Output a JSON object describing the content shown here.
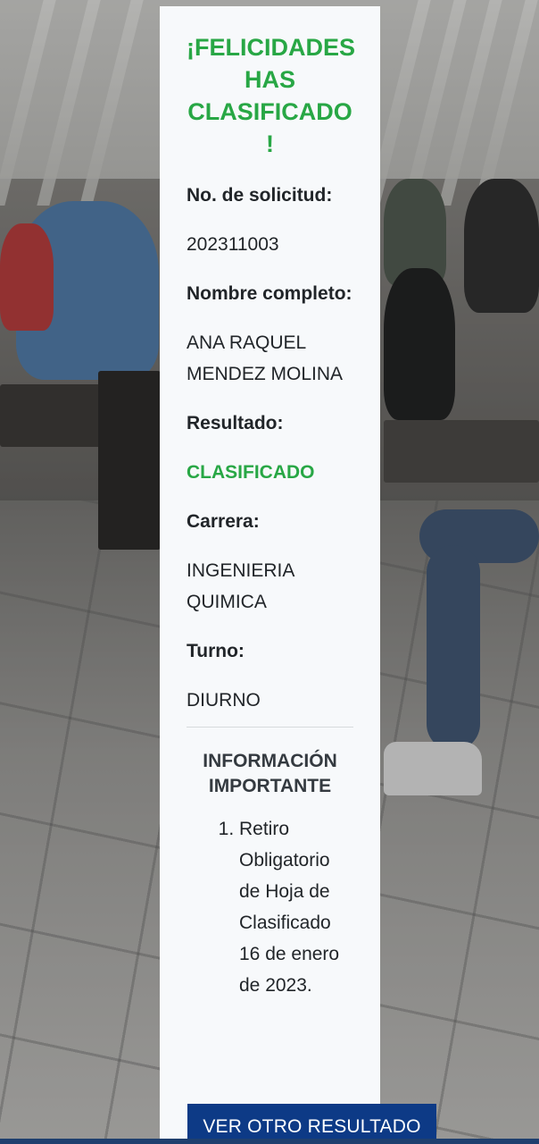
{
  "card": {
    "title": "¡FELICIDADES HAS CLASIFICADO !",
    "fields": {
      "solicitud_label": "No. de solicitud:",
      "solicitud_value": "202311003",
      "nombre_label": "Nombre completo:",
      "nombre_value": "ANA RAQUEL MENDEZ MOLINA",
      "resultado_label": "Resultado:",
      "resultado_value": "CLASIFICADO",
      "carrera_label": "Carrera:",
      "carrera_value": "INGENIERIA QUIMICA",
      "turno_label": "Turno:",
      "turno_value": "DIURNO"
    },
    "info": {
      "title": "INFORMACIÓN IMPORTANTE",
      "items": [
        "Retiro Obligatorio de Hoja de Clasificado 16 de enero de 2023."
      ]
    },
    "button_label": "VER OTRO RESULTADO"
  },
  "colors": {
    "success_green": "#28a745",
    "button_blue": "#0d3a86",
    "card_background": "#f7f9fb"
  }
}
